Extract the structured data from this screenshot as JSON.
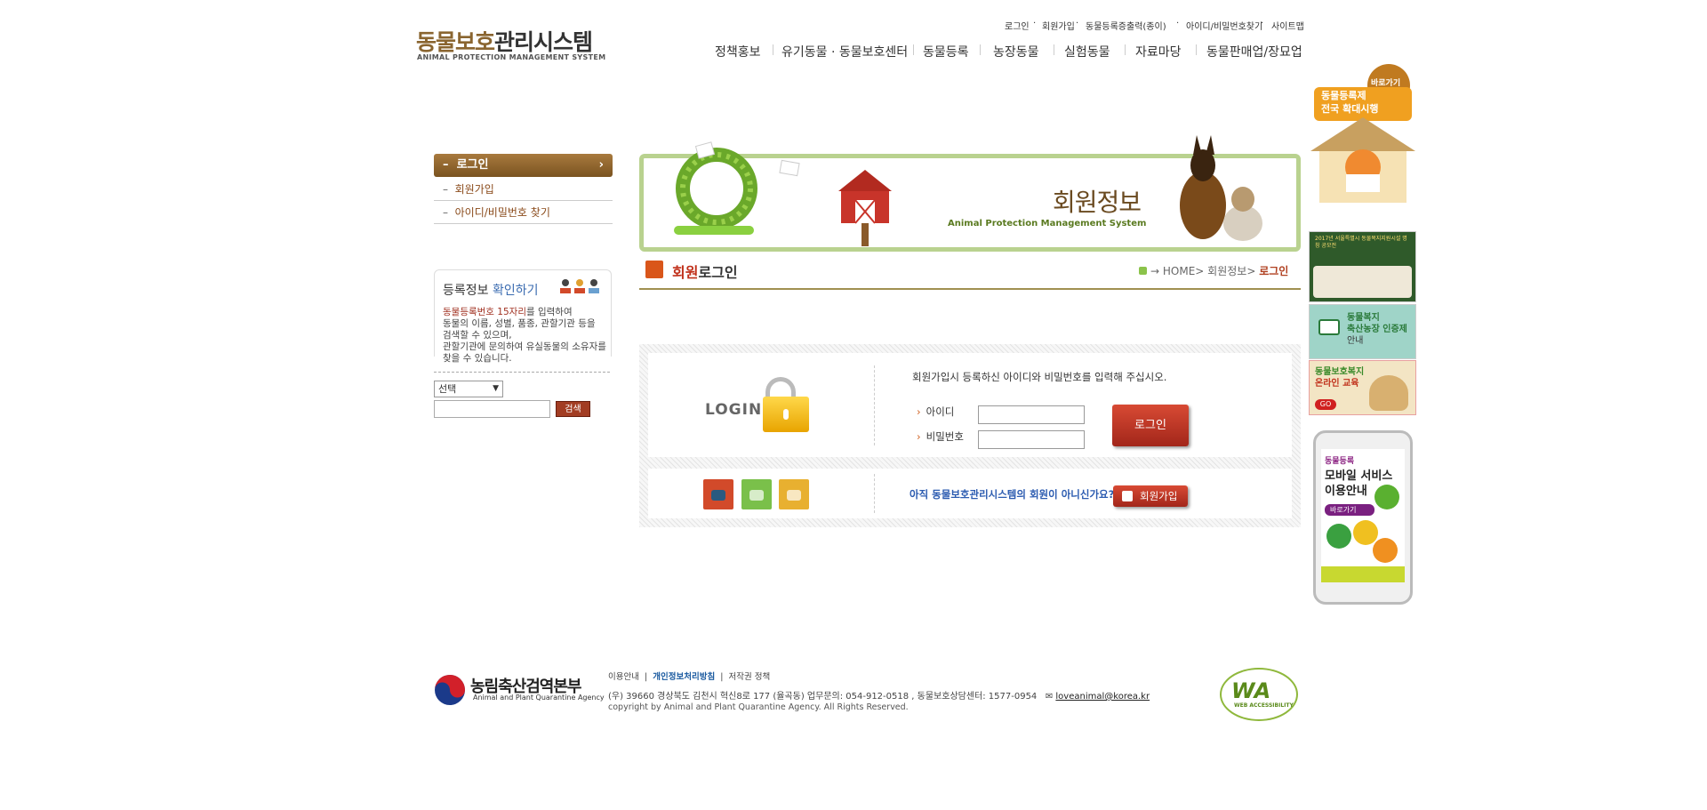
{
  "header": {
    "logo_brown": "동물보호",
    "logo_dark": "관리시스템",
    "logo_en": "ANIMAL PROTECTION MANAGEMENT SYSTEM",
    "util": [
      "로그인",
      "회원가입",
      "동물등록증출력(종이)",
      "아이디/비밀번호찾기",
      "사이트맵"
    ],
    "nav": [
      "정책홍보",
      "유기동물 · 동물보호센터",
      "동물등록",
      "농장동물",
      "실험동물",
      "자료마당",
      "동물판매업/장묘업"
    ]
  },
  "sidebar": {
    "active": "로그인",
    "items": [
      "회원가입",
      "아이디/비밀번호 찾기"
    ],
    "reg": {
      "title_a": "등록정보",
      "title_b": "확인하기",
      "desc_red": "동물등록번호 15자리",
      "desc_1": "를 입력하여",
      "desc_2": "동물의 이름, 성별, 품종, 관할기관 등을",
      "desc_3": "검색할 수 있으며,",
      "desc_4": "관할기관에 문의하여 유실동물의 소유자를",
      "desc_5": "찾을 수 있습니다.",
      "select_value": "선택",
      "search_button": "검색"
    }
  },
  "banner": {
    "title": "회원정보",
    "subtitle": "Animal Protection Management System"
  },
  "page": {
    "title_red": "회원",
    "title_dark": "로그인",
    "breadcrumb": [
      "HOME",
      "회원정보",
      "로그인"
    ]
  },
  "login": {
    "label": "LOGIN",
    "message": "회원가입시 등록하신 아이디와 비밀번호를 입력해 주십시오.",
    "id_label": "아이디",
    "pw_label": "비밀번호",
    "button": "로그인",
    "join_message": "아직 동물보호관리시스템의 회원이 아니신가요?",
    "join_button": "회원가입"
  },
  "right_banners": {
    "quick_button": "바로가기",
    "quick_title_1": "동물등록제",
    "quick_title_2": "전국 확대시행",
    "b1_line": "2017년 서울특별시 동물복지지원시설 명칭 공모전",
    "b2_line1": "동물복지",
    "b2_line2": "축산농장 인증제",
    "b2_line3": "안내",
    "b3_line1": "동물보호복지",
    "b3_line2": "온라인 교육",
    "go": "GO",
    "phone_title": "동물등록",
    "phone_line1": "모바일 서비스",
    "phone_line2": "이용안내",
    "phone_button": "바로가기"
  },
  "footer": {
    "logo_ko": "농림축산검역본부",
    "logo_en": "Animal and Plant Quarantine Agency",
    "links": [
      "이용안내",
      "개인정보처리방침",
      "저작권 정책"
    ],
    "address": "(우) 39660   경상북도 김천시 혁신8로 177 (율곡동)   업무문의: 054-912-0518 ,  동물보호상담센터: 1577-0954",
    "email": "loveanimal@korea.kr",
    "copyright": "copyright by Animal and Plant Quarantine Agency. All Rights Reserved.",
    "wa": "WA",
    "wa_text": "WEB ACCESSIBILITY"
  },
  "colors": {
    "brown": "#8a6530",
    "accent_red": "#c0301a",
    "green": "#b9d28f",
    "link_blue": "#2b5bb0"
  }
}
